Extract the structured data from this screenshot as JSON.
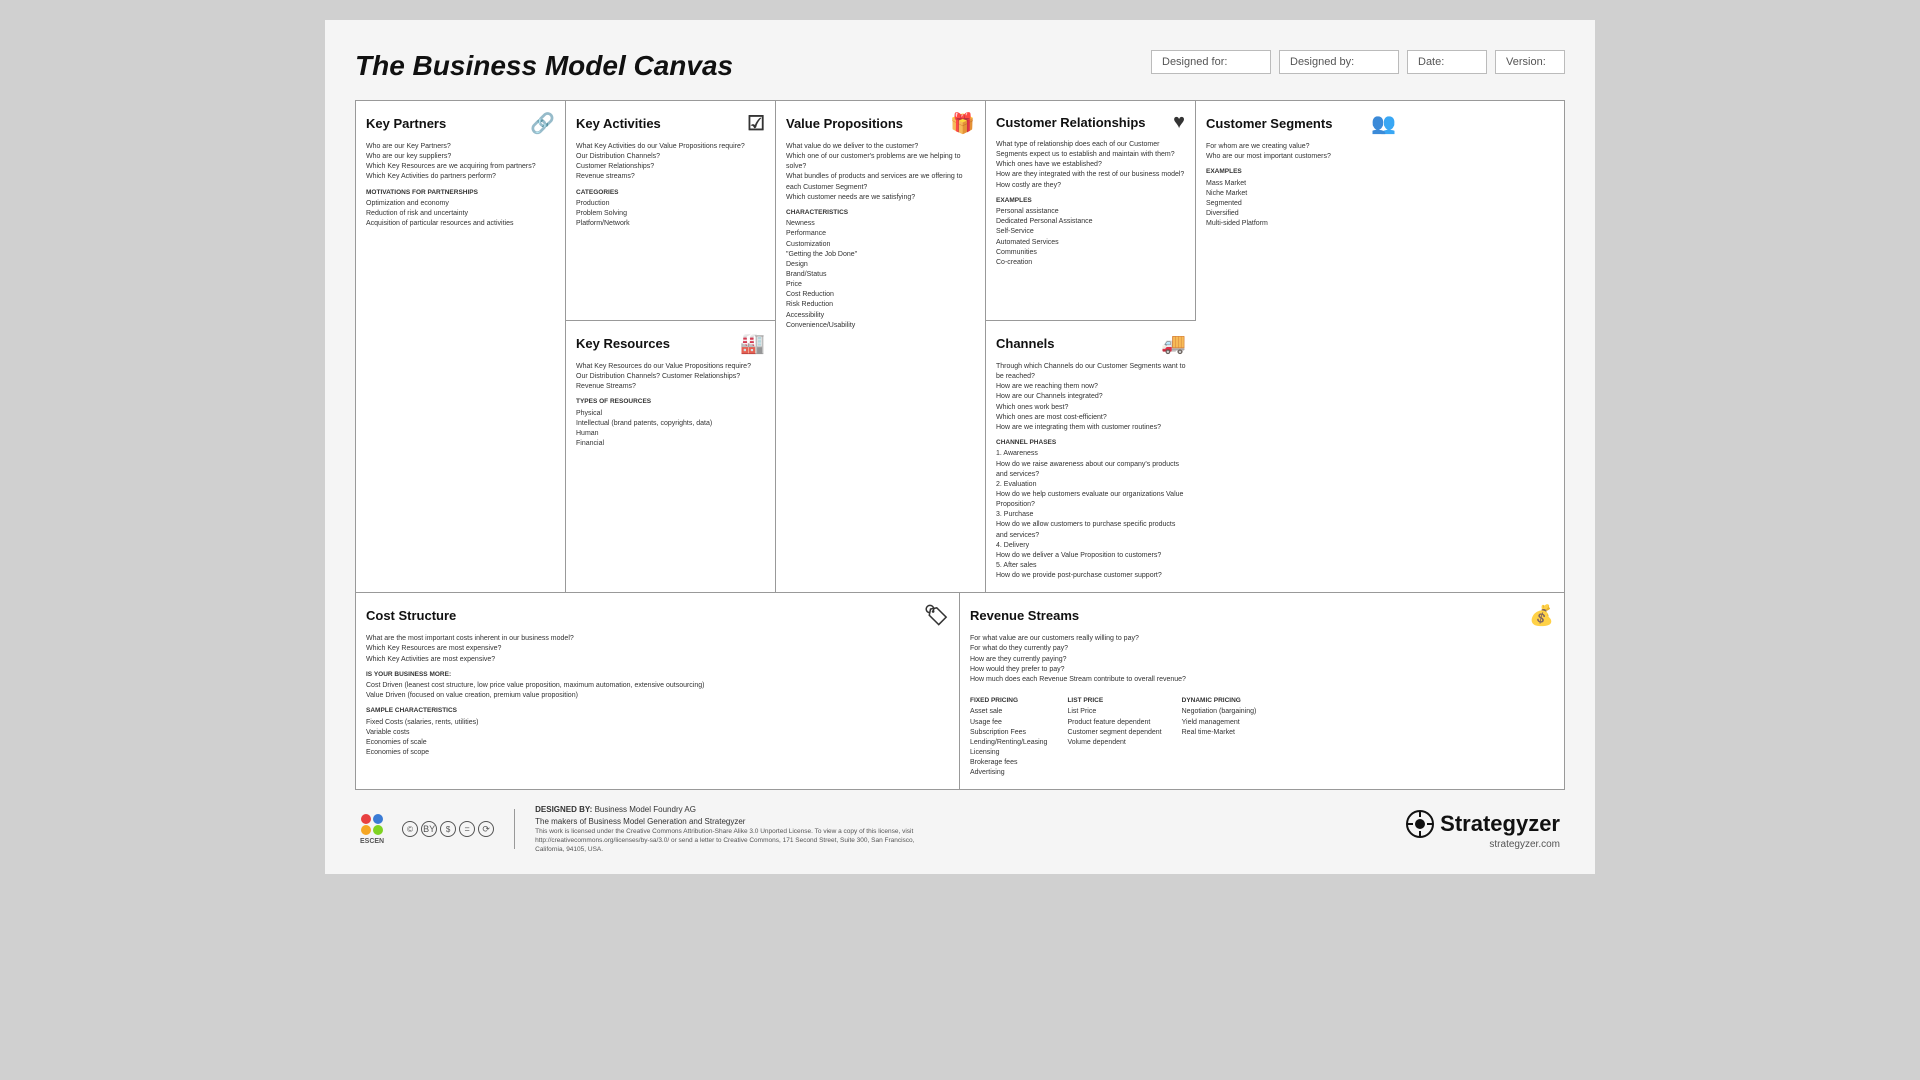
{
  "header": {
    "title": "The Business Model Canvas",
    "designed_for_label": "Designed for:",
    "designed_by_label": "Designed by:",
    "date_label": "Date:",
    "version_label": "Version:"
  },
  "cells": {
    "key_partners": {
      "title": "Key Partners",
      "icon": "🔗",
      "questions": "Who are our Key Partners?\nWho are our key suppliers?\nWhich Key Resources are we acquiring from partners?\nWhich Key Activities do partners perform?",
      "motivations_label": "MOTIVATIONS FOR PARTNERSHIPS",
      "motivations": "Optimization and economy\nReduction of risk and uncertainty\nAcquisition of particular resources and activities"
    },
    "key_activities": {
      "title": "Key Activities",
      "icon": "☑",
      "questions": "What Key Activities do our Value Propositions require?\nOur Distribution Channels?\nCustomer Relationships?\nRevenue streams?",
      "categories_label": "CATEGORIES",
      "categories": "Production\nProblem Solving\nPlatform/Network"
    },
    "value_propositions": {
      "title": "Value Propositions",
      "icon": "🎁",
      "questions": "What value do we deliver to the customer?\nWhich one of our customer's problems are we helping to solve?\nWhat bundles of products and services are we offering to each Customer Segment?\nWhich customer needs are we satisfying?",
      "characteristics_label": "CHARACTERISTICS",
      "characteristics": "Newness\nPerformance\nCustomization\n\"Getting the Job Done\"\nDesign\nBrand/Status\nPrice\nCost Reduction\nRisk Reduction\nAccessibility\nConvenience/Usability"
    },
    "customer_relationships": {
      "title": "Customer Relationships",
      "icon": "♥",
      "questions": "What type of relationship does each of our Customer Segments expect us to establish and maintain with them?\nWhich ones have we established?\nHow are they integrated with the rest of our business model?\nHow costly are they?",
      "examples_label": "EXAMPLES",
      "examples": "Personal assistance\nDedicated Personal Assistance\nSelf-Service\nAutomated Services\nCommunities\nCo-creation"
    },
    "customer_segments": {
      "title": "Customer Segments",
      "icon": "👥",
      "questions": "For whom are we creating value?\nWho are our most important customers?",
      "examples_label": "EXAMPLES",
      "examples": "Mass Market\nNiche Market\nSegmented\nDiversified\nMulti-sided Platform"
    },
    "key_resources": {
      "title": "Key Resources",
      "icon": "🏭",
      "questions": "What Key Resources do our Value Propositions require?\nOur Distribution Channels? Customer Relationships?\nRevenue Streams?",
      "types_label": "TYPES OF RESOURCES",
      "types": "Physical\nIntellectual (brand patents, copyrights, data)\nHuman\nFinancial"
    },
    "channels": {
      "title": "Channels",
      "icon": "🚚",
      "questions": "Through which Channels do our Customer Segments want to be reached?\nHow are we reaching them now?\nHow are our Channels integrated?\nWhich ones work best?\nWhich ones are most cost-efficient?\nHow are we integrating them with customer routines?",
      "phases_label": "CHANNEL PHASES",
      "phases": "1. Awareness\n   How do we raise awareness about our company's products and services?\n2. Evaluation\n   How do we help customers evaluate our organizations Value Proposition?\n3. Purchase\n   How do we allow customers to purchase specific products and services?\n4. Delivery\n   How do we deliver a Value Proposition to customers?\n5. After sales\n   How do we provide post-purchase customer support?"
    },
    "cost_structure": {
      "title": "Cost Structure",
      "icon": "🏷",
      "questions": "What are the most important costs inherent in our business model?\nWhich Key Resources are most expensive?\nWhich Key Activities are most expensive?",
      "is_your_label": "IS YOUR BUSINESS MORE:",
      "is_your": "Cost Driven (leanest cost structure, low price value proposition, maximum automation, extensive outsourcing)\nValue Driven (focused on value creation, premium value proposition)",
      "characteristics_label": "SAMPLE CHARACTERISTICS",
      "characteristics": "Fixed Costs (salaries, rents, utilities)\nVariable costs\nEconomies of scale\nEconomies of scope"
    },
    "revenue_streams": {
      "title": "Revenue Streams",
      "icon": "💰",
      "questions": "For what value are our customers really willing to pay?\nFor what do they currently pay?\nHow are they currently paying?\nHow would they prefer to pay?\nHow much does each Revenue Stream contribute to overall revenue?",
      "fixed_label": "FIXED PRICING",
      "fixed": "Asset sale\nUsage fee\nSubscription Fees\nLending/Renting/Leasing\nLicensing\nBrokerage fees\nAdvertising",
      "list_label": "LIST PRICE",
      "list": "List Price\nProduct feature dependent\nCustomer segment dependent\nVolume dependent",
      "dynamic_label": "DYNAMIC PRICING",
      "dynamic": "Negotiation (bargaining)\nYield management\nReal time-Market"
    }
  },
  "footer": {
    "designed_by_label": "DESIGNED BY:",
    "designed_by": "Business Model Foundry AG",
    "tagline": "The makers of Business Model Generation and Strategyzer",
    "legal": "This work is licensed under the Creative Commons Attribution-Share Alike 3.0 Unported License. To view a copy of this license, visit\nhttp://creativecommons.org/licenses/by-sa/3.0/ or send a letter to Creative Commons, 171 Second Street, Suite 300, San Francisco, California, 94105, USA.",
    "brand": "Strategyzer",
    "brand_url": "strategyzer.com",
    "escen": "ESCEN"
  }
}
